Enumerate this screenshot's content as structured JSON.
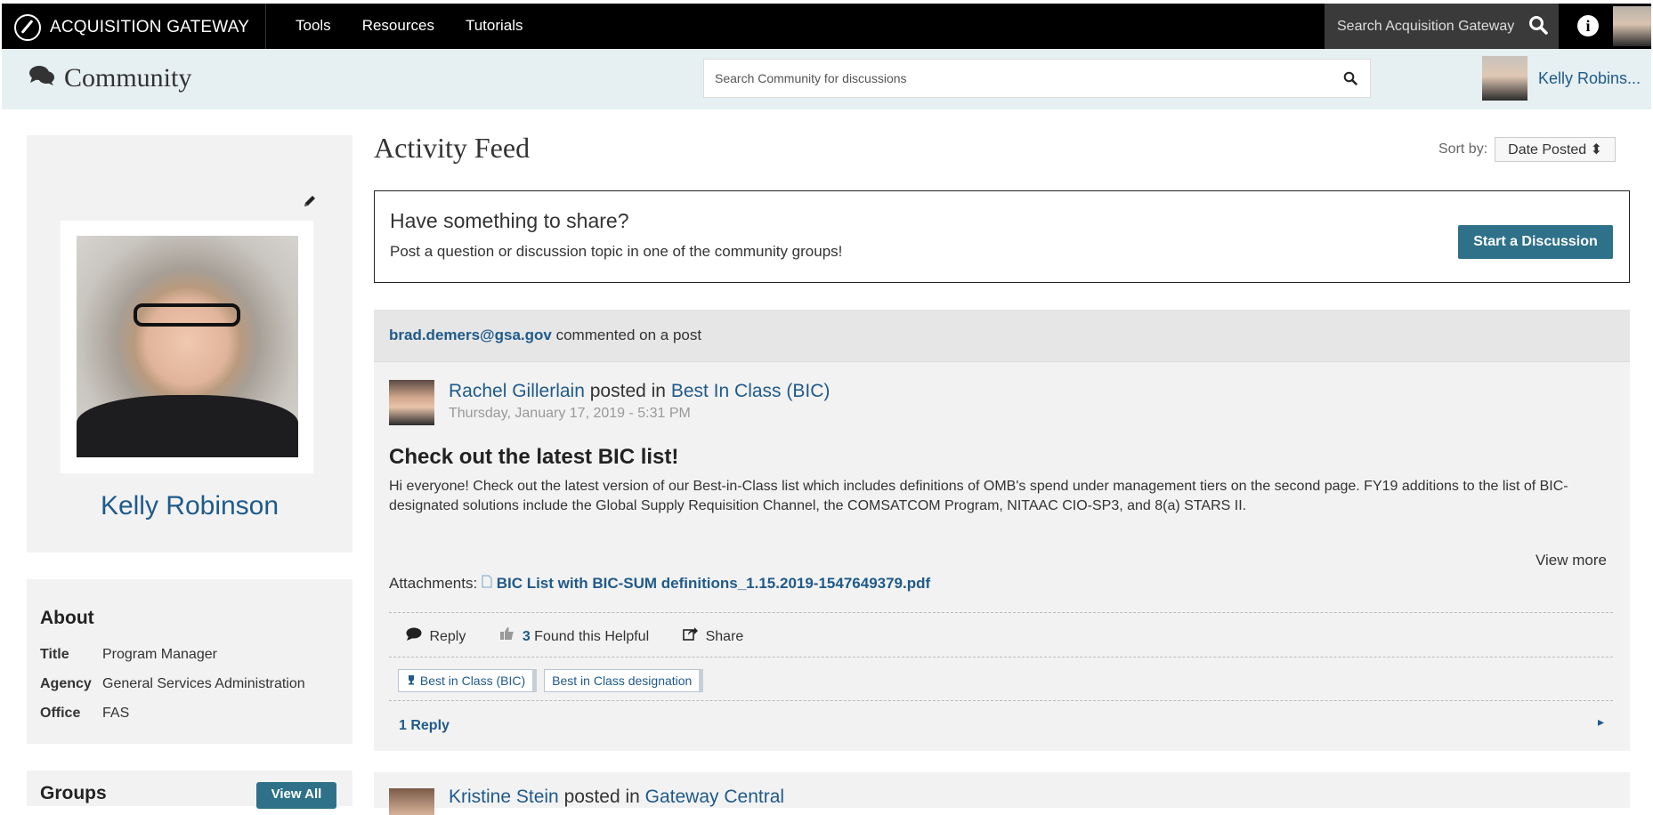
{
  "topbar": {
    "brand": "ACQUISITION GATEWAY",
    "nav": [
      "Tools",
      "Resources",
      "Tutorials"
    ],
    "search_placeholder": "Search Acquisition Gateway"
  },
  "subbar": {
    "title": "Community",
    "search_placeholder": "Search Community for discussions",
    "user_name": "Kelly Robins..."
  },
  "profile": {
    "name": "Kelly Robinson"
  },
  "about": {
    "heading": "About",
    "rows": [
      {
        "label": "Title",
        "value": "Program Manager"
      },
      {
        "label": "Agency",
        "value": "General Services Administration"
      },
      {
        "label": "Office",
        "value": "FAS"
      }
    ]
  },
  "groups": {
    "heading": "Groups",
    "view_all": "View All"
  },
  "feed": {
    "title": "Activity Feed",
    "sort_label": "Sort by:",
    "sort_value": "Date Posted"
  },
  "share": {
    "heading": "Have something to share?",
    "subtext": "Post a question or discussion topic in one of the community groups!",
    "button": "Start a Discussion"
  },
  "post": {
    "activity_user": "brad.demers@gsa.gov",
    "activity_text": "commented on a post",
    "author": "Rachel Gillerlain",
    "posted_in": "posted in",
    "group": "Best In Class (BIC)",
    "date": "Thursday, January 17, 2019 - 5:31 PM",
    "title": "Check out the latest BIC list!",
    "body": "Hi everyone! Check out the latest version of our Best-in-Class list which includes definitions of OMB's spend under management tiers on the second page. FY19 additions to the list of BIC-designated solutions include the Global Supply Requisition Channel, the COMSATCOM Program, NITAAC CIO-SP3, and 8(a) STARS II.",
    "view_more": "View more",
    "attachments_label": "Attachments:",
    "attachment_file": "BIC List with BIC-SUM definitions_1.15.2019-1547649379.pdf",
    "actions": {
      "reply": "Reply",
      "helpful_count": "3",
      "helpful_text": "Found this Helpful",
      "share": "Share"
    },
    "tags": [
      "Best in Class (BIC)",
      "Best in Class designation"
    ],
    "replies": "1 Reply"
  },
  "next_post": {
    "author": "Kristine Stein",
    "posted_in": "posted in",
    "group": "Gateway Central"
  }
}
